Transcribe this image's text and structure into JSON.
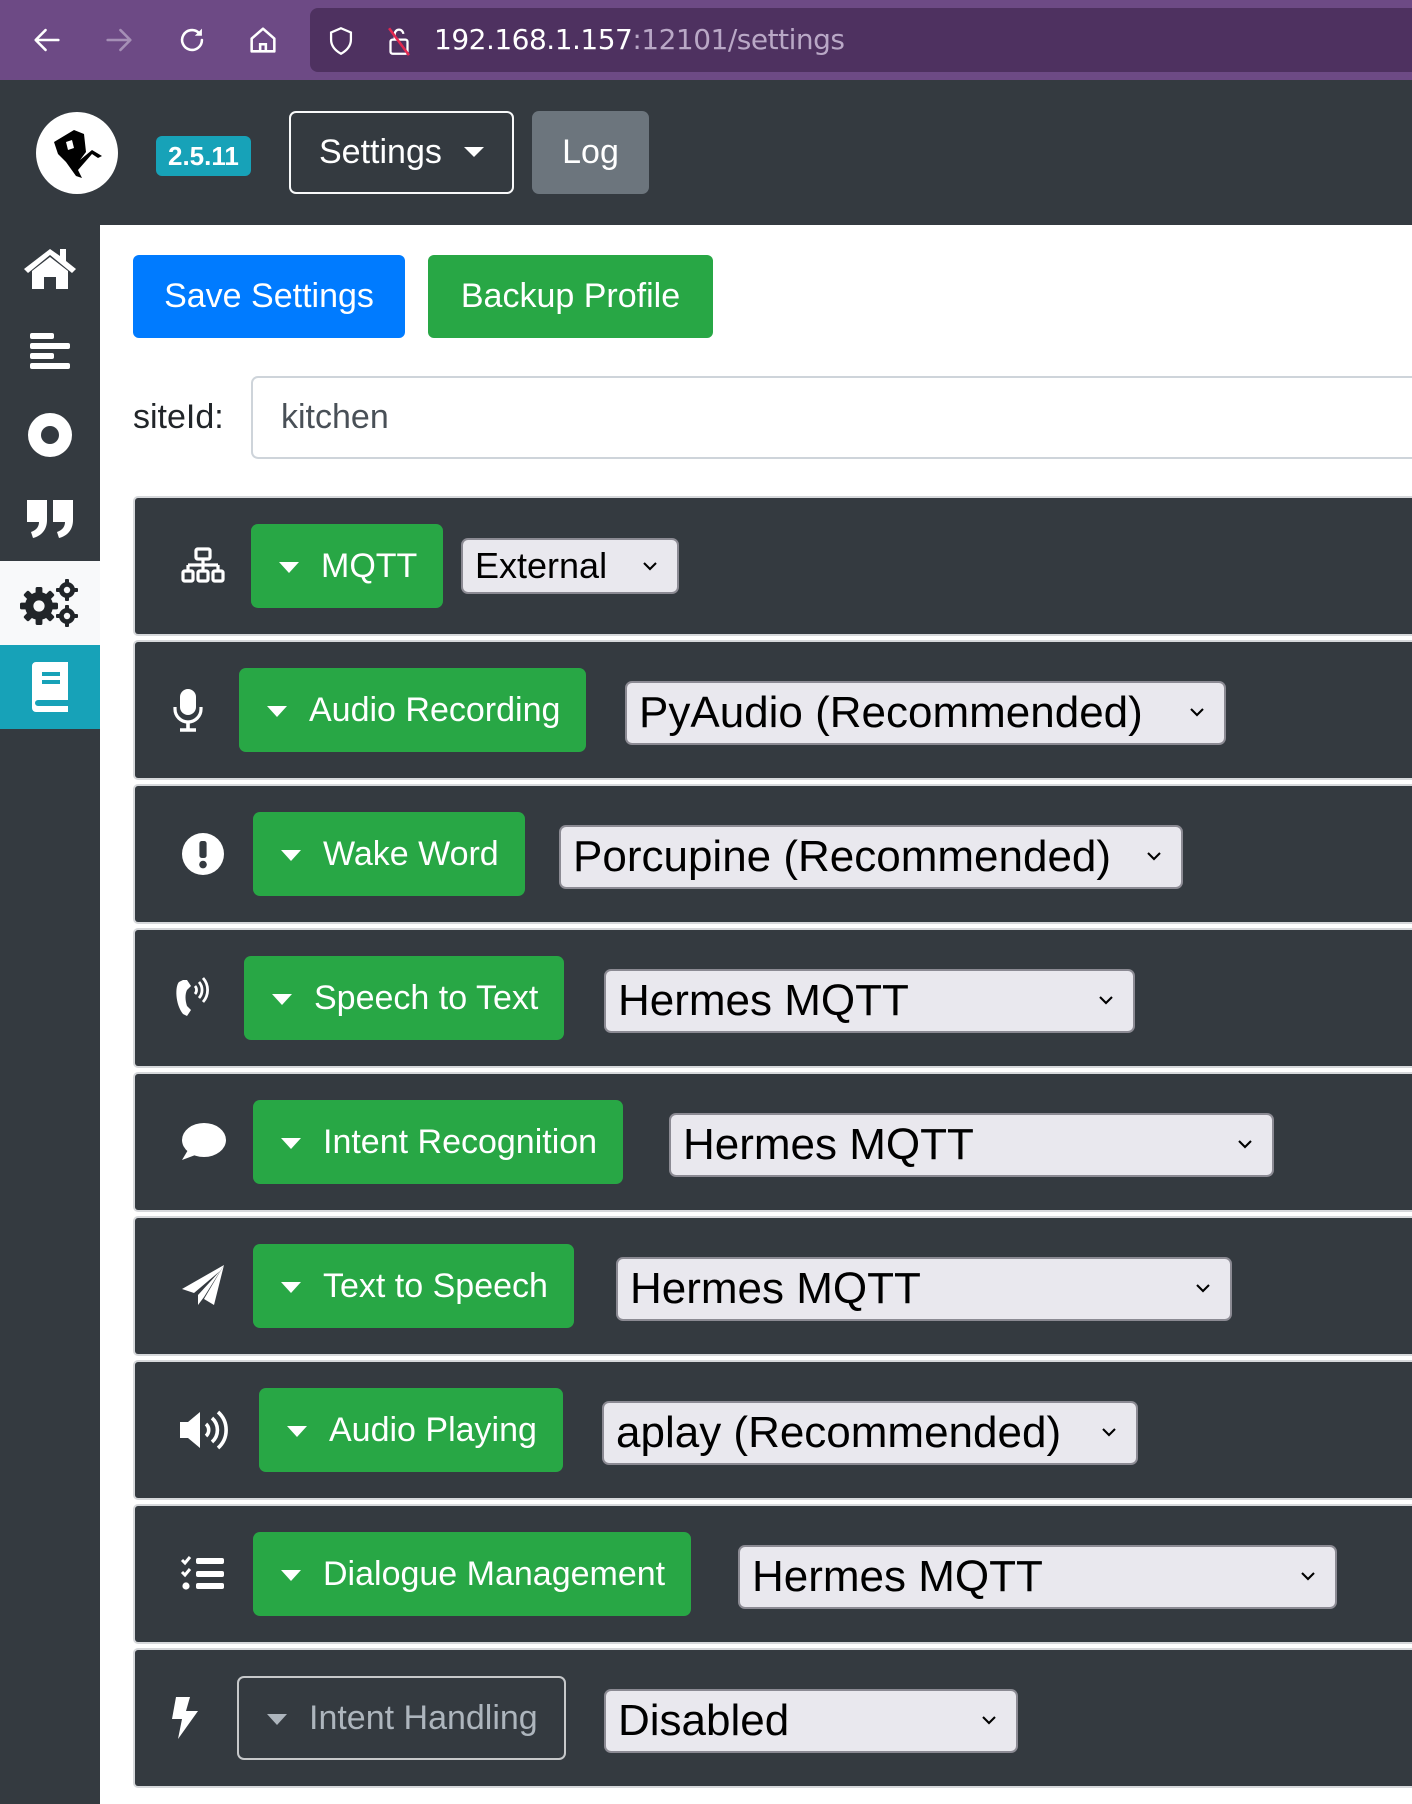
{
  "browser": {
    "url_host": "192.168.1.157",
    "url_rest": ":12101/settings"
  },
  "navbar": {
    "version": "2.5.11",
    "settings_label": "Settings",
    "log_label": "Log"
  },
  "sidebar": {
    "items": [
      {
        "name": "home",
        "icon": "home-icon"
      },
      {
        "name": "sentences",
        "icon": "align-left-icon"
      },
      {
        "name": "record",
        "icon": "dot-circle-icon"
      },
      {
        "name": "words",
        "icon": "quote-icon"
      },
      {
        "name": "settings",
        "icon": "cogs-icon",
        "active": true
      },
      {
        "name": "docs",
        "icon": "book-icon",
        "highlight": true
      }
    ]
  },
  "toolbar": {
    "save_label": "Save Settings",
    "backup_label": "Backup Profile"
  },
  "siteid": {
    "label": "siteId:",
    "value": "kitchen"
  },
  "services": [
    {
      "label": "MQTT",
      "icon": "network-icon",
      "value": "External",
      "enabled": true
    },
    {
      "label": "Audio Recording",
      "icon": "microphone-icon",
      "value": "PyAudio (Recommended)",
      "enabled": true
    },
    {
      "label": "Wake Word",
      "icon": "exclamation-circle-icon",
      "value": "Porcupine (Recommended)",
      "enabled": true
    },
    {
      "label": "Speech to Text",
      "icon": "phone-volume-icon",
      "value": "Hermes MQTT",
      "enabled": true
    },
    {
      "label": "Intent Recognition",
      "icon": "comment-icon",
      "value": "Hermes MQTT",
      "enabled": true
    },
    {
      "label": "Text to Speech",
      "icon": "paper-plane-icon",
      "value": "Hermes MQTT",
      "enabled": true
    },
    {
      "label": "Audio Playing",
      "icon": "volume-up-icon",
      "value": "aplay (Recommended)",
      "enabled": true
    },
    {
      "label": "Dialogue Management",
      "icon": "tasks-icon",
      "value": "Hermes MQTT",
      "enabled": true
    },
    {
      "label": "Intent Handling",
      "icon": "bolt-icon",
      "value": "Disabled",
      "enabled": false
    }
  ],
  "colors": {
    "primary": "#007bff",
    "success": "#28a745",
    "info": "#17a2b8",
    "secondary": "#6c757d",
    "dark": "#343a40",
    "browser_purple": "#6d4a85"
  }
}
